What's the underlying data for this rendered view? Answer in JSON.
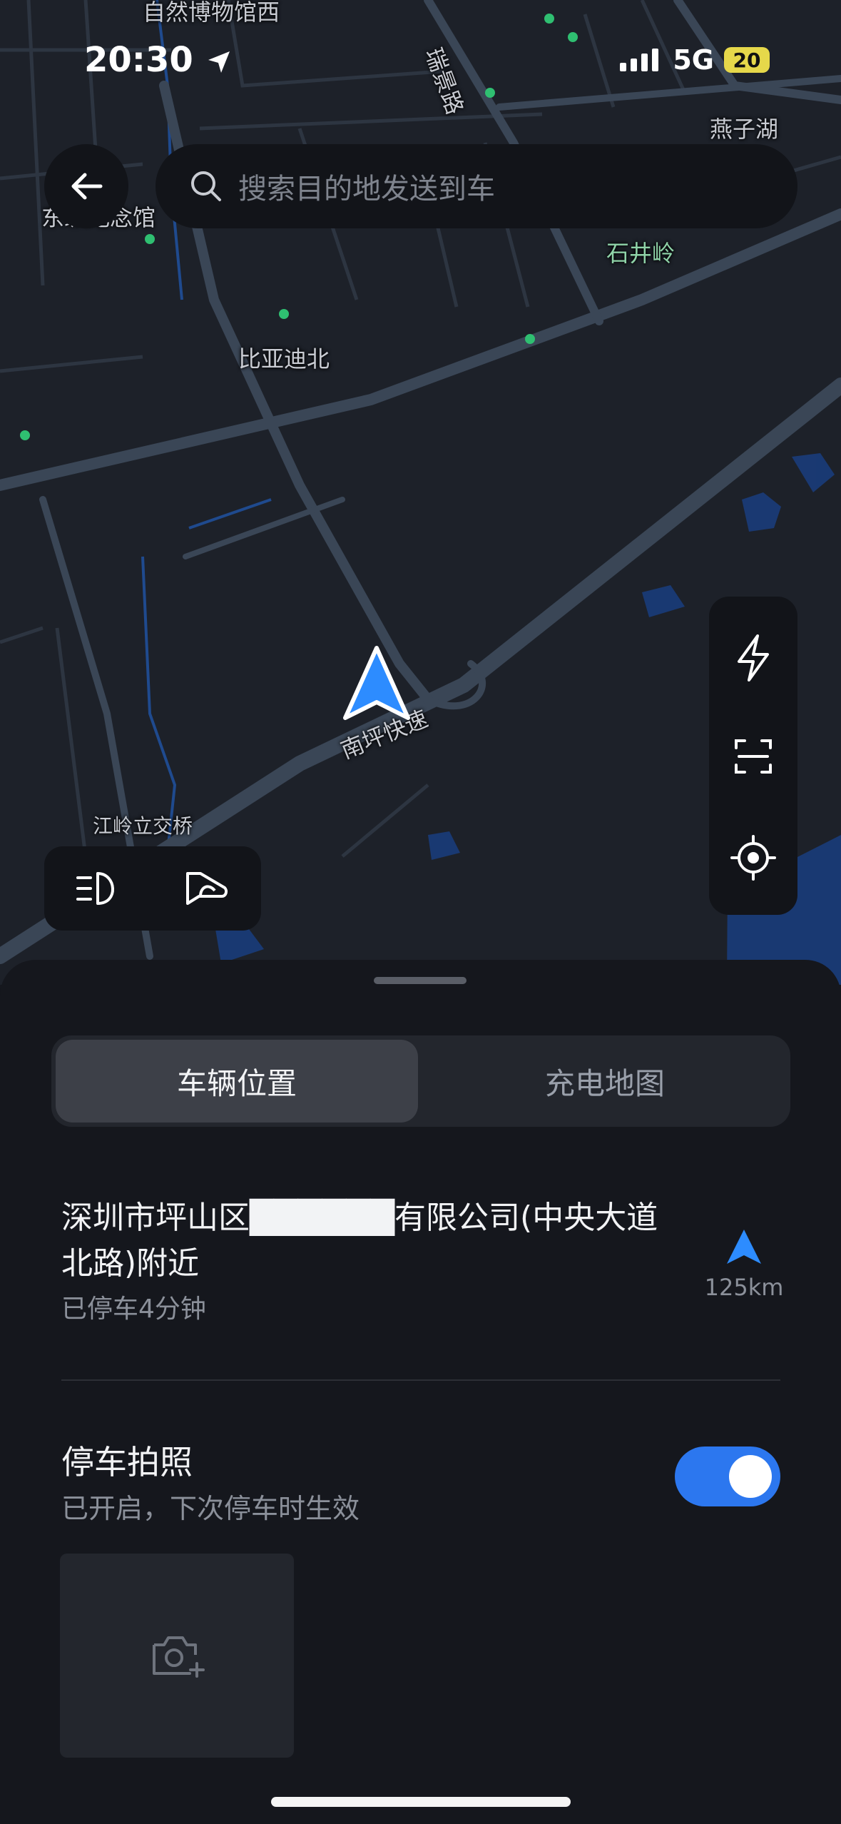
{
  "status_bar": {
    "time": "20:30",
    "network": "5G",
    "battery": "20"
  },
  "search": {
    "placeholder": "搜索目的地发送到车"
  },
  "map": {
    "labels": {
      "museum": "自然博物馆西",
      "ruijing": "瑞景路",
      "yanzihu": "燕子湖",
      "memorial": "东纵纪念馆",
      "shijingling": "石井岭",
      "biyadibei": "比亚迪北",
      "highway": "南坪快速",
      "bridge": "江岭立交桥"
    },
    "colors": {
      "road": "#3a4656",
      "water": "#1a3c7a",
      "poi": "#2fbf71",
      "car_arrow": "#2d8cff"
    }
  },
  "controls": {
    "right": [
      "lightning-icon",
      "scan-icon",
      "locate-icon"
    ],
    "left": [
      "headlight-icon",
      "horn-icon"
    ]
  },
  "tabs": [
    {
      "label": "车辆位置",
      "active": true
    },
    {
      "label": "充电地图",
      "active": false
    }
  ],
  "vehicle": {
    "location": "深圳市坪山区██████有限公司(中央大道北路)附近",
    "parked": "已停车4分钟",
    "distance": "125km"
  },
  "parking_photo": {
    "title": "停车拍照",
    "subtitle": "已开启，下次停车时生效",
    "enabled": true
  }
}
